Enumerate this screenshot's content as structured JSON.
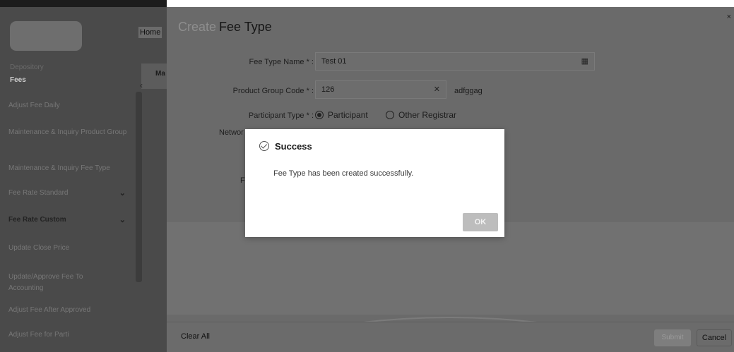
{
  "sidebar": {
    "home_tab": "Home",
    "tab_fragment": "Ma",
    "section_depository": "Depository",
    "section_fees": "Fees",
    "items": [
      {
        "label": "Adjust Fee Daily",
        "chevron": false
      },
      {
        "label": "Maintenance & Inquiry Product Group",
        "chevron": false
      },
      {
        "label": "Maintenance & Inquiry Fee Type",
        "chevron": false
      },
      {
        "label": "Fee Rate Standard",
        "chevron": true
      },
      {
        "label": "Fee Rate Custom",
        "chevron": true
      },
      {
        "label": "Update Close Price",
        "chevron": false
      },
      {
        "label": "Update/Approve Fee To Accounting",
        "chevron": false
      },
      {
        "label": "Adjust Fee After Approved",
        "chevron": false
      },
      {
        "label": "Adjust Fee for Parti",
        "chevron": false
      }
    ]
  },
  "form": {
    "title_prefix": "Create",
    "title": "Fee Type",
    "fields": {
      "fee_type_name": {
        "label": "Fee Type Name * :",
        "value": "Test 01"
      },
      "product_group_code": {
        "label": "Product Group Code * :",
        "value": "126",
        "suffix": "adfggag"
      },
      "participant_type": {
        "label": "Participant Type * :",
        "options": [
          "Participant",
          "Other Registrar"
        ],
        "selected": "Participant"
      },
      "network_label_fragment": "Networ",
      "f_label_fragment": "F"
    },
    "actions": {
      "clear": "Clear All",
      "submit": "Submit",
      "cancel": "Cancel"
    }
  },
  "dialog": {
    "title": "Success",
    "message": "Fee Type has been created successfully.",
    "ok_label": "OK"
  },
  "icons": {
    "table": "table-icon",
    "clear": "clear-x-icon",
    "success": "check-circle-icon",
    "chevron": "chevron-down-icon"
  }
}
